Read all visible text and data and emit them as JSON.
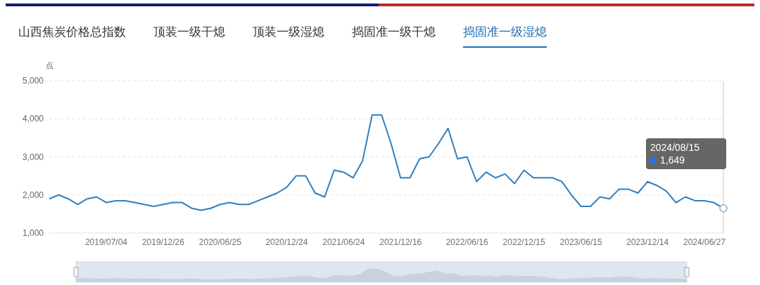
{
  "tabs": [
    {
      "label": "山西焦炭价格总指数",
      "selected": false
    },
    {
      "label": "顶装一级干熄",
      "selected": false
    },
    {
      "label": "顶装一级湿熄",
      "selected": false
    },
    {
      "label": "捣固准一级干熄",
      "selected": false
    },
    {
      "label": "捣固准一级湿熄",
      "selected": true
    }
  ],
  "chart": {
    "chart_data": {
      "type": "line",
      "grid": true,
      "ylabel": "点",
      "ylim": [
        1000,
        5000
      ],
      "yticks": [
        {
          "value": 1000,
          "label": "1,000"
        },
        {
          "value": 2000,
          "label": "2,000"
        },
        {
          "value": 3000,
          "label": "3,000"
        },
        {
          "value": 4000,
          "label": "4,000"
        },
        {
          "value": 5000,
          "label": "5,000"
        }
      ],
      "categories": [
        null,
        null,
        null,
        null,
        null,
        null,
        "2019/07/04",
        null,
        null,
        null,
        null,
        null,
        "2019/12/26",
        null,
        null,
        null,
        null,
        null,
        "2020/06/25",
        null,
        null,
        null,
        null,
        null,
        null,
        "2020/12/24",
        null,
        null,
        null,
        null,
        null,
        "2021/06/24",
        null,
        null,
        null,
        null,
        null,
        "2021/12/16",
        null,
        null,
        null,
        null,
        null,
        null,
        "2022/06/16",
        null,
        null,
        null,
        null,
        null,
        "2022/12/15",
        null,
        null,
        null,
        null,
        null,
        "2023/06/15",
        null,
        null,
        null,
        null,
        null,
        null,
        "2023/12/14",
        null,
        null,
        null,
        null,
        null,
        "2024/06/27",
        null,
        null
      ],
      "series": [
        {
          "color": "#2f7fc1",
          "values": [
            1900,
            2000,
            1900,
            1750,
            1900,
            1950,
            1800,
            1850,
            1850,
            1800,
            1750,
            1700,
            1750,
            1800,
            1800,
            1650,
            1600,
            1650,
            1750,
            1800,
            1750,
            1750,
            1850,
            1950,
            2050,
            2200,
            2500,
            2500,
            2050,
            1950,
            2650,
            2600,
            2450,
            2900,
            4100,
            4100,
            3350,
            2450,
            2450,
            2950,
            3000,
            3350,
            3750,
            2950,
            3000,
            2350,
            2600,
            2450,
            2550,
            2300,
            2650,
            2450,
            2450,
            2450,
            2350,
            2000,
            1700,
            1700,
            1950,
            1900,
            2150,
            2150,
            2050,
            2350,
            2250,
            2100,
            1800,
            1950,
            1850,
            1850,
            1800,
            1649
          ]
        }
      ]
    },
    "tooltip": {
      "date": "2024/08/15",
      "value": "1,649",
      "color": "#1677ff"
    }
  }
}
